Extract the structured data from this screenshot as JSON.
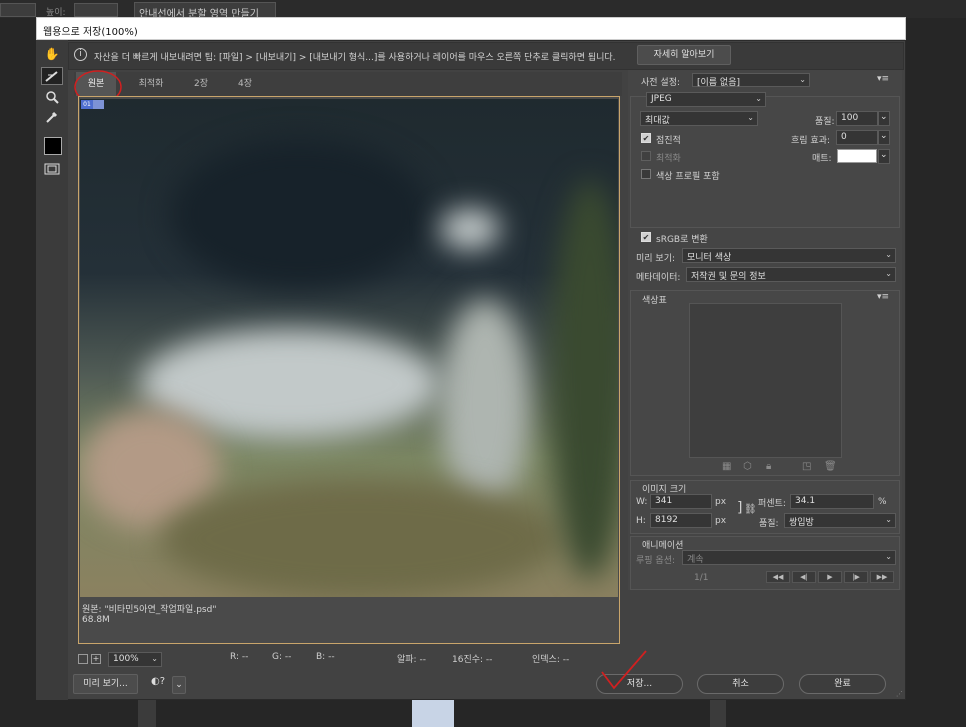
{
  "background": {
    "field_label": "높이:",
    "tab_title": "안내선에서 분할 영역 만들기"
  },
  "dialog": {
    "title": "웹용으로 저장(100%)",
    "tip": "자산을 더 빠르게 내보내려면 팁: [파일] > [내보내기] > [내보내기 형식...]를 사용하거나 레이어를 마우스 오른쪽 단추로 클릭하면 됩니다.",
    "learn_more": "자세히 알아보기",
    "tabs": [
      "원본",
      "최적화",
      "2장",
      "4장"
    ],
    "active_tab": "원본",
    "slice_badge": "01",
    "image_info": {
      "name": "원본: \"비타민5아연_작업파일.psd\"",
      "size": "68.8M"
    },
    "status": {
      "zoom": "100%",
      "r": "R: --",
      "g": "G: --",
      "b": "B: --",
      "alpha": "알파: --",
      "hex": "16진수: --",
      "index": "인덱스: --"
    },
    "buttons": {
      "preview": "미리 보기...",
      "save": "저장...",
      "cancel": "취소",
      "done": "완료"
    },
    "settings": {
      "preset_label": "사전 설정:",
      "preset_value": "[이름 없음]",
      "format": "JPEG",
      "quality_preset": "최대값",
      "quality_label": "품질:",
      "quality_value": "100",
      "progressive": "점진적",
      "optimized": "최적화",
      "embed_profile": "색상 프로필 포함",
      "blur_label": "흐림 효과:",
      "blur_value": "0",
      "matte_label": "매트:",
      "srgb": "sRGB로 변환",
      "preview_label": "미리 보기:",
      "preview_value": "모니터 색상",
      "metadata_label": "메타데이터:",
      "metadata_value": "저작권 및 문의 정보"
    },
    "color_table": {
      "title": "색상표"
    },
    "image_size": {
      "title": "이미지 크기",
      "w_label": "W:",
      "w_value": "341",
      "h_label": "H:",
      "h_value": "8192",
      "unit": "px",
      "percent_label": "퍼센트:",
      "percent_value": "34.1",
      "percent_unit": "%",
      "quality_label": "품질:",
      "quality_value": "쌍입방"
    },
    "animation": {
      "title": "애니메이션",
      "loop_label": "루핑 옵션:",
      "loop_value": "계속",
      "frame_counter": "1/1"
    }
  },
  "colors": {
    "accent_circle": "#d02020",
    "frame_border": "#c9a56b"
  }
}
